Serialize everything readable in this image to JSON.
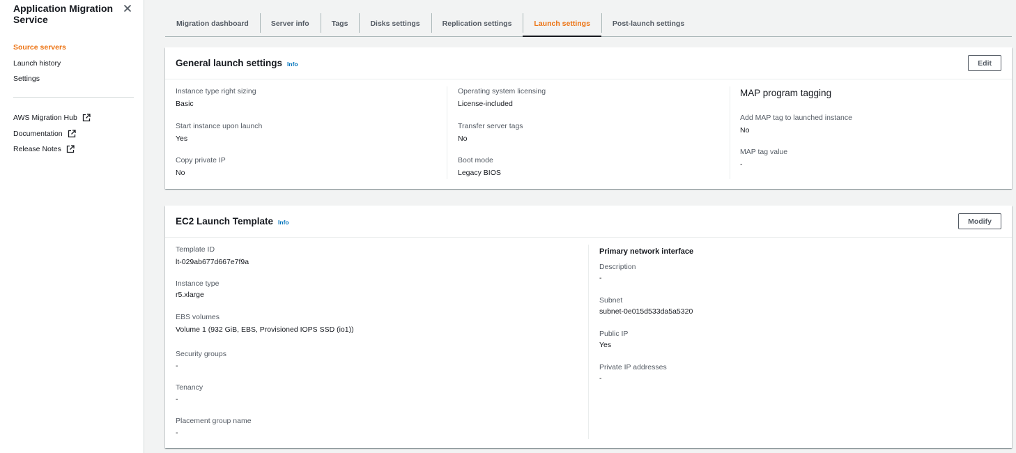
{
  "sidebar": {
    "title": "Application Migration Service",
    "nav": [
      "Source servers",
      "Launch history",
      "Settings"
    ],
    "active_nav": "Source servers",
    "external_links": [
      "AWS Migration Hub",
      "Documentation",
      "Release Notes"
    ]
  },
  "tabs": [
    "Migration dashboard",
    "Server info",
    "Tags",
    "Disks settings",
    "Replication settings",
    "Launch settings",
    "Post-launch settings"
  ],
  "active_tab": "Launch settings",
  "general": {
    "title": "General launch settings",
    "info": "Info",
    "edit_label": "Edit",
    "col1": [
      {
        "label": "Instance type right sizing",
        "value": "Basic"
      },
      {
        "label": "Start instance upon launch",
        "value": "Yes"
      },
      {
        "label": "Copy private IP",
        "value": "No"
      }
    ],
    "col2": [
      {
        "label": "Operating system licensing",
        "value": "License-included"
      },
      {
        "label": "Transfer server tags",
        "value": "No"
      },
      {
        "label": "Boot mode",
        "value": "Legacy BIOS"
      }
    ],
    "map": {
      "heading": "MAP program tagging",
      "items": [
        {
          "label": "Add MAP tag to launched instance",
          "value": "No"
        },
        {
          "label": "MAP tag value",
          "value": "-"
        }
      ]
    }
  },
  "ec2": {
    "title": "EC2 Launch Template",
    "info": "Info",
    "modify_label": "Modify",
    "left": [
      {
        "label": "Template ID",
        "value": "lt-029ab677d667e7f9a"
      },
      {
        "label": "Instance type",
        "value": "r5.xlarge"
      },
      {
        "label": "EBS volumes",
        "value": "Volume 1 (932 GiB, EBS, Provisioned IOPS SSD (io1))"
      },
      {
        "label": "Security groups",
        "value": "-"
      },
      {
        "label": "Tenancy",
        "value": "-"
      },
      {
        "label": "Placement group name",
        "value": "-"
      }
    ],
    "network": {
      "heading": "Primary network interface",
      "items": [
        {
          "label": "Description",
          "value": "-"
        },
        {
          "label": "Subnet",
          "value": "subnet-0e015d533da5a5320"
        },
        {
          "label": "Public IP",
          "value": "Yes"
        },
        {
          "label": "Private IP addresses",
          "value": "-"
        }
      ]
    }
  },
  "colors": {
    "accent": "#ec7211",
    "link": "#0073bb",
    "text": "#16191f",
    "label": "#545b64"
  }
}
